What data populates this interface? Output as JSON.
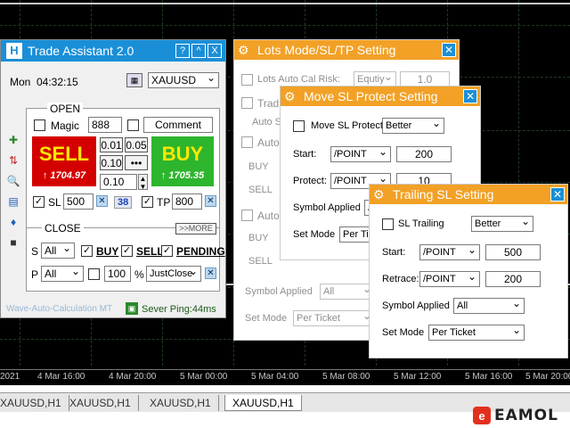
{
  "chart": {
    "x_ticks": [
      "2021",
      "4 Mar 16:00",
      "4 Mar 20:00",
      "5 Mar 00:00",
      "5 Mar 04:00",
      "5 Mar 08:00",
      "5 Mar 12:00",
      "5 Mar 16:00",
      "5 Mar 20:00"
    ],
    "tabs": [
      "XAUUSD,H1",
      "XAUUSD,H1",
      "XAUUSD,H1",
      "XAUUSD,H1"
    ]
  },
  "logo": {
    "mark": "e",
    "text": "EAMOL"
  },
  "trade_assistant": {
    "title": "Trade Assistant 2.0",
    "buttons": [
      "?",
      "^",
      "X"
    ],
    "day": "Mon",
    "time": "04:32:15",
    "symbol": "XAUUSD",
    "open_label": "OPEN",
    "magic_label": "Magic",
    "magic_value": "888",
    "comment_label": "Comment",
    "sell_label": "SELL",
    "sell_price": "1704.97",
    "buy_label": "BUY",
    "buy_price": "1705.35",
    "lots": [
      "0.01",
      "0.05",
      "0.10",
      "•••"
    ],
    "lot_value": "0.10",
    "sl_label": "SL",
    "sl_value": "500",
    "spread": "38",
    "tp_label": "TP",
    "tp_value": "800",
    "close_label": "CLOSE",
    "more_label": ">>MORE",
    "s_label": "S",
    "s_select": "All",
    "buy_chk": "BUY",
    "sell_chk": "SELL",
    "pending_chk": "PENDING",
    "p_label": "P",
    "p_select": "All",
    "percent_value": "100",
    "percent_sign": "%",
    "close_mode": "JustClose",
    "footer_left": "Wave-Auto-Calculation MT",
    "footer_ping": "Sever Ping:44ms"
  },
  "lots_mode": {
    "title": "Lots Mode/SL/TP Setting",
    "auto_calc_label": "Lots Auto Cal Risk:",
    "auto_calc_select": "Equtiy",
    "auto_calc_value": "1.0",
    "trade_label": "Trad",
    "auto_se_label": "Auto Se",
    "auto_label": "Auto",
    "buy_label": "BUY",
    "sell_label": "SELL",
    "auto2_label": "Auto",
    "buy2_label": "BUY",
    "sell2_label": "SELL",
    "symbol_applied_label": "Symbol Applied",
    "symbol_applied_value": "All",
    "set_mode_label": "Set Mode",
    "set_mode_value": "Per Ticket"
  },
  "move_sl": {
    "title": "Move SL Protect Setting",
    "chk_label": "Move SL Protect",
    "mode": "Better",
    "start_label": "Start:",
    "start_unit": "/POINT",
    "start_value": "200",
    "protect_label": "Protect:",
    "protect_unit": "/POINT",
    "protect_value": "10",
    "symbol_applied_label": "Symbol Applied",
    "symbol_applied_value": "A",
    "set_mode_label": "Set Mode",
    "set_mode_value": "Per Ti"
  },
  "trailing": {
    "title": "Trailing SL Setting",
    "chk_label": "SL Trailing",
    "mode": "Better",
    "start_label": "Start:",
    "start_unit": "/POINT",
    "start_value": "500",
    "retrace_label": "Retrace:",
    "retrace_unit": "/POINT",
    "retrace_value": "200",
    "symbol_applied_label": "Symbol Applied",
    "symbol_applied_value": "All",
    "set_mode_label": "Set Mode",
    "set_mode_value": "Per Ticket"
  }
}
